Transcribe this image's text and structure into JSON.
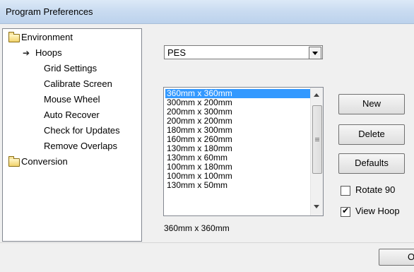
{
  "window": {
    "title": "Program Preferences"
  },
  "tree": {
    "items": [
      {
        "label": "Environment",
        "type": "folder"
      },
      {
        "label": "Hoops",
        "type": "child",
        "selected": true
      },
      {
        "label": "Grid Settings",
        "type": "child"
      },
      {
        "label": "Calibrate Screen",
        "type": "child"
      },
      {
        "label": "Mouse Wheel",
        "type": "child"
      },
      {
        "label": "Auto Recover",
        "type": "child"
      },
      {
        "label": "Check for Updates",
        "type": "child"
      },
      {
        "label": "Remove Overlaps",
        "type": "child"
      },
      {
        "label": "Conversion",
        "type": "folder"
      }
    ]
  },
  "format_select": {
    "value": "PES"
  },
  "hoop_list": {
    "items": [
      "360mm x 360mm",
      "300mm x 200mm",
      "200mm x 300mm",
      "200mm x 200mm",
      "180mm x 300mm",
      "160mm x 260mm",
      "130mm x 180mm",
      "130mm x 60mm",
      "100mm x 180mm",
      "100mm x 100mm",
      "130mm x 50mm"
    ],
    "selected_index": 0
  },
  "buttons": {
    "new": "New",
    "delete": "Delete",
    "defaults": "Defaults"
  },
  "options": {
    "rotate": {
      "label": "Rotate 90",
      "checked": false
    },
    "view_hoop": {
      "label": "View Hoop",
      "checked": true
    }
  },
  "selected_hoop_text": "360mm x 360mm",
  "footer": {
    "ok_label": "O"
  },
  "colors": {
    "selection": "#3399ff",
    "titlebar": "#cadcf1"
  }
}
